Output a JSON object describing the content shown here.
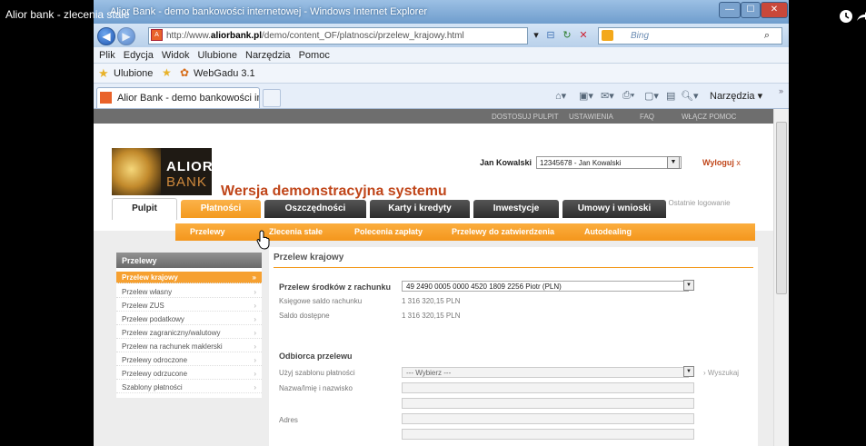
{
  "video": {
    "title": "Alior bank - zlecenia stałe"
  },
  "window": {
    "title": "Alior Bank - demo bankowości internetowej - Windows Internet Explorer",
    "controls": [
      "—",
      "☐",
      "✕"
    ]
  },
  "address": {
    "url_prefix": "http://www.",
    "url_domain": "aliorbank.pl",
    "url_path": "/demo/content_OF/platnosci/przelew_krajowy.html",
    "search_placeholder": "Bing"
  },
  "menu": {
    "items": [
      "Plik",
      "Edycja",
      "Widok",
      "Ulubione",
      "Narzędzia",
      "Pomoc"
    ]
  },
  "favorites": {
    "label": "Ulubione",
    "webgadu": "WebGadu 3.1"
  },
  "tab": {
    "label": "Alior Bank - demo bankowości intern..."
  },
  "toolbar": {
    "tools_label": "Narzędzia"
  },
  "site": {
    "top_links": [
      "DOSTOSUJ PULPIT",
      "USTAWIENIA",
      "FAQ",
      "WŁĄCZ POMOC"
    ],
    "logo_line1": "ALIOR",
    "logo_line2": "BANK",
    "slogan": "Wersja demonstracyjna systemu",
    "user_name": "Jan Kowalski",
    "account_select": "12345678 - Jan Kowalski",
    "logout": "Wyloguj",
    "logout_x": "x",
    "last_login": "Ostatnie logowanie",
    "nav": [
      "Pulpit",
      "Płatności",
      "Oszczędności",
      "Karty i kredyty",
      "Inwestycje",
      "Umowy i wnioski"
    ],
    "subnav": [
      "Przelewy",
      "Zlecenia stałe",
      "Polecenia zapłaty",
      "Przelewy do zatwierdzenia",
      "Autodealing"
    ]
  },
  "sidebar": {
    "header": "Przelewy",
    "items": [
      "Przelew krajowy",
      "Przelew własny",
      "Przelew ZUS",
      "Przelew podatkowy",
      "Przelew zagraniczny/walutowy",
      "Przelew na rachunek maklerski",
      "Przelewy odroczone",
      "Przelewy odrzucone",
      "Szablony płatności"
    ]
  },
  "form": {
    "title": "Przelew krajowy",
    "from_label": "Przelew środków z rachunku",
    "from_value": "49 2490 0005 0000 4520 1809 2256 Piotr (PLN)",
    "book_balance_label": "Księgowe saldo rachunku",
    "book_balance_value": "1 316 320,15 PLN",
    "available_label": "Saldo dostępne",
    "available_value": "1 316 320,15 PLN",
    "recipient_title": "Odbiorca przelewu",
    "template_label": "Użyj szablonu płatności",
    "template_value": "--- Wybierz ---",
    "search_link": "Wyszukaj",
    "name_label": "Nazwa/Imię i nazwisko",
    "address_label": "Adres"
  }
}
